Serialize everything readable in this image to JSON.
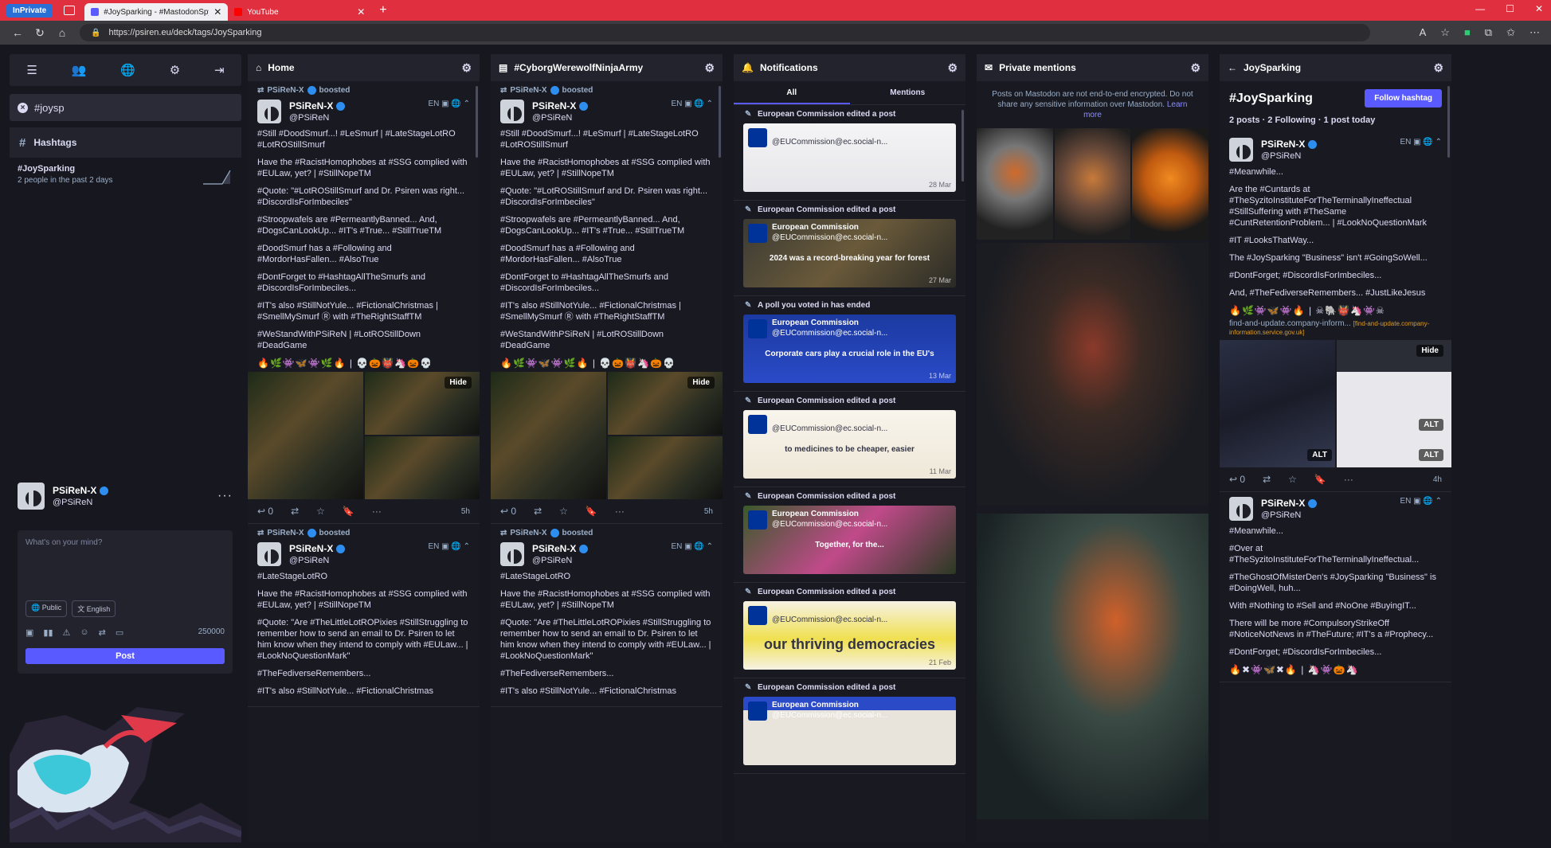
{
  "browser": {
    "private_label": "InPrivate",
    "tabs": [
      {
        "title": "#JoySparking - #MastodonSpyBa",
        "active": true
      },
      {
        "title": "YouTube",
        "active": false
      }
    ],
    "url": "https://psiren.eu/deck/tags/JoySparking"
  },
  "sidebar": {
    "search_value": "#joysp",
    "hashtags_heading": "Hashtags",
    "hashtag_result": {
      "tag": "#JoySparking",
      "sub": "2 people in the past 2 days"
    },
    "account": {
      "name": "PSiReN-X",
      "handle": "@PSiReN"
    },
    "composer": {
      "placeholder": "What's on your mind?",
      "visibility": "Public",
      "language": "English",
      "char_count": "250000",
      "post_label": "Post"
    }
  },
  "columns": {
    "home": {
      "title": "Home",
      "post1": {
        "boost": "PSiReN-X",
        "boost_suffix": "boosted",
        "name": "PSiReN-X",
        "handle": "@PSiReN",
        "lang": "EN",
        "p1": "#Still #DoodSmurf...! #LeSmurf | #LateStageLotRO #LotROStillSmurf",
        "p2": "Have the #RacistHomophobes at #SSG complied with #EULaw, yet? | #StillNopeTM",
        "p3": "#Quote: \"#LotROStillSmurf and Dr. Psiren was right... #DiscordIsForImbeciles\"",
        "p4": "#Stroopwafels are #PermeantlyBanned... And, #DogsCanLookUp... #IT's #True... #StillTrueTM",
        "p5": "#DoodSmurf has a #Following and #MordorHasFallen... #AlsoTrue",
        "p6": "#DontForget to #HashtagAllTheSmurfs and #DiscordIsForImbeciles...",
        "p7": "#IT's also #StillNotYule... #FictionalChristmas | #SmellMySmurf Ⓡ with #TheRightStaffTM",
        "p8": "#WeStandWithPSiReN | #LotROStillDown #DeadGame",
        "emojis": "🔥🌿👾🦋👾🌿🔥 | 💀🎃👹🦄🎃💀",
        "hide": "Hide",
        "reply_count": "0",
        "time": "5h"
      },
      "post2": {
        "boost": "PSiReN-X",
        "boost_suffix": "boosted",
        "name": "PSiReN-X",
        "handle": "@PSiReN",
        "lang": "EN",
        "p1": "#LateStageLotRO",
        "p2": "Have the #RacistHomophobes at #SSG complied with #EULaw, yet? | #StillNopeTM",
        "p3": "#Quote: \"Are #TheLittleLotROPixies #StillStruggling to remember how to send an email to Dr. Psiren to let him know when they intend to comply with #EULaw... | #LookNoQuestionMark\"",
        "p4": "#TheFediverseRemembers...",
        "p5": "#IT's also #StillNotYule... #FictionalChristmas"
      }
    },
    "cyborg": {
      "title": "#CyborgWerewolfNinjaArmy"
    },
    "notifications": {
      "title": "Notifications",
      "tab_all": "All",
      "tab_mentions": "Mentions",
      "items": [
        {
          "line": "European Commission edited a post",
          "name": "",
          "handle": "@EUCommission@ec.social-n...",
          "date": "28 Mar",
          "caption": ""
        },
        {
          "line": "European Commission edited a post",
          "name": "European Commission",
          "handle": "@EUCommission@ec.social-n...",
          "date": "27 Mar",
          "caption": "2024 was a record-breaking year for forest"
        },
        {
          "line": "A poll you voted in has ended",
          "name": "European Commission",
          "handle": "@EUCommission@ec.social-n...",
          "date": "13 Mar",
          "caption": "Corporate cars play a crucial role in the EU's"
        },
        {
          "line": "European Commission edited a post",
          "name": "",
          "handle": "@EUCommission@ec.social-n...",
          "date": "11 Mar",
          "caption": "to medicines to be cheaper, easier"
        },
        {
          "line": "European Commission edited a post",
          "name": "European Commission",
          "handle": "@EUCommission@ec.social-n...",
          "date": "",
          "caption": "Together, for the..."
        },
        {
          "line": "European Commission edited a post",
          "name": "",
          "handle": "@EUCommission@ec.social-n...",
          "date": "21 Feb",
          "caption": "our thriving democracies"
        },
        {
          "line": "European Commission edited a post",
          "name": "European Commission",
          "handle": "@EUCommission@ec.social-n...",
          "date": "",
          "caption": ""
        }
      ]
    },
    "private": {
      "title": "Private mentions",
      "note": "Posts on Mastodon are not end-to-end encrypted. Do not share any sensitive information over Mastodon.",
      "learn_more": "Learn more"
    },
    "joysparking": {
      "title": "JoySparking",
      "tag": "#JoySparking",
      "follow": "Follow hashtag",
      "stats": "2 posts · 2 Following · 1 post today",
      "post1": {
        "name": "PSiReN-X",
        "handle": "@PSiReN",
        "lang": "EN",
        "p1": "#Meanwhile...",
        "p2": "Are the #Cuntards at #TheSyzitoInstituteForTheTerminallyIneffectual #StillSuffering with #TheSame #CuntRetentionProblem... | #LookNoQuestionMark",
        "p3": "#IT #LooksThatWay...",
        "p4": "The #JoySparking \"Business\" isn't #GoingSoWell...",
        "p5": "#DontForget; #DiscordIsForImbeciles...",
        "p6": "And, #TheFediverseRemembers... #JustLikeJesus",
        "emojis": "🔥🌿👾🦋👾🔥 | ☠🐘👹🦄👾☠",
        "link": "find-and-update.company-inform...",
        "link_small": "[find-and-update.company-information.service.gov.uk]",
        "hide": "Hide",
        "alt": "ALT",
        "reply_count": "0",
        "time": "4h"
      },
      "post2": {
        "name": "PSiReN-X",
        "handle": "@PSiReN",
        "lang": "EN",
        "p1": "#Meanwhile...",
        "p2": "#Over at #TheSyzitoInstituteForTheTerminallyIneffectual...",
        "p3": "#TheGhostOfMisterDen's #JoySparking \"Business\" is #DoingWell, huh...",
        "p4": "With #Nothing to #Sell and #NoOne #BuyingIT...",
        "p5": "There will be more #CompulsoryStrikeOff #NoticeNotNews in #TheFuture; #IT's a #Prophecy...",
        "p6": "#DontForget; #DiscordIsForImbeciles...",
        "emojis": "🔥✖👾🦋✖🔥 | 🦄👾🎃🦄"
      }
    }
  }
}
